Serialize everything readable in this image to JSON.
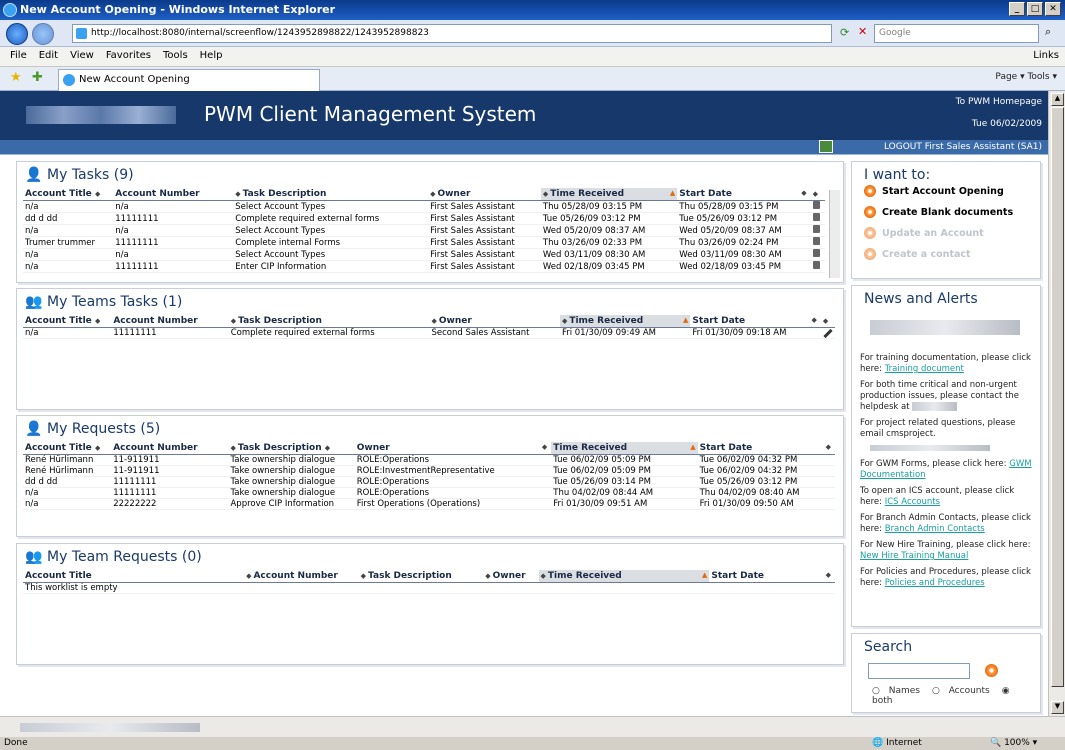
{
  "window": {
    "title": "New Account Opening - Windows Internet Explorer"
  },
  "browser": {
    "address": "http://localhost:8080/internal/screenflow/1243952898822/1243952898823",
    "search_placeholder": "Google",
    "menu": [
      "File",
      "Edit",
      "View",
      "Favorites",
      "Tools",
      "Help"
    ],
    "links_label": "Links",
    "tab_title": "New Account Opening",
    "toolbar_tools": "Page ▾  Tools ▾",
    "status_text": "Done",
    "zone": "Internet",
    "zoom": "100%"
  },
  "header": {
    "system_name": "PWM Client Management System",
    "home_link": "To PWM Homepage",
    "date": "Tue 06/02/2009",
    "logout": "LOGOUT First Sales Assistant (SA1)"
  },
  "my_tasks": {
    "title": "My Tasks (9)",
    "columns": [
      "Account Title",
      "Account Number",
      "Task Description",
      "Owner",
      "Time Received",
      "Start Date"
    ],
    "rows": [
      [
        "n/a",
        "n/a",
        "Select Account Types",
        "First Sales Assistant",
        "Thu 05/28/09 03:15 PM",
        "Thu 05/28/09 03:15 PM"
      ],
      [
        "dd d dd",
        "11111111",
        "Complete required external forms",
        "First Sales Assistant",
        "Tue 05/26/09 03:12 PM",
        "Tue 05/26/09 03:12 PM"
      ],
      [
        "n/a",
        "n/a",
        "Select Account Types",
        "First Sales Assistant",
        "Wed 05/20/09 08:37 AM",
        "Wed 05/20/09 08:37 AM"
      ],
      [
        "Trumer trummer",
        "11111111",
        "Complete internal Forms",
        "First Sales Assistant",
        "Thu 03/26/09 02:33 PM",
        "Thu 03/26/09 02:24 PM"
      ],
      [
        "n/a",
        "n/a",
        "Select Account Types",
        "First Sales Assistant",
        "Wed 03/11/09 08:30 AM",
        "Wed 03/11/09 08:30 AM"
      ],
      [
        "n/a",
        "11111111",
        "Enter CIP Information",
        "First Sales Assistant",
        "Wed 02/18/09 03:45 PM",
        "Wed 02/18/09 03:45 PM"
      ]
    ]
  },
  "my_teams_tasks": {
    "title": "My Teams Tasks (1)",
    "columns": [
      "Account Title",
      "Account Number",
      "Task Description",
      "Owner",
      "Time Received",
      "Start Date"
    ],
    "rows": [
      [
        "n/a",
        "11111111",
        "Complete required external forms",
        "Second Sales Assistant",
        "Fri 01/30/09 09:49 AM",
        "Fri 01/30/09 09:18 AM"
      ]
    ]
  },
  "my_requests": {
    "title": "My Requests (5)",
    "columns": [
      "Account Title",
      "Account Number",
      "Task Description",
      "Owner",
      "Time Received",
      "Start Date"
    ],
    "rows": [
      [
        "René Hürlimann",
        "11-911911",
        "Take ownership dialogue",
        "ROLE:Operations",
        "Tue 06/02/09 05:09 PM",
        "Tue 06/02/09 04:32 PM"
      ],
      [
        "René Hürlimann",
        "11-911911",
        "Take ownership dialogue",
        "ROLE:InvestmentRepresentative",
        "Tue 06/02/09 05:09 PM",
        "Tue 06/02/09 04:32 PM"
      ],
      [
        "dd d dd",
        "11111111",
        "Take ownership dialogue",
        "ROLE:Operations",
        "Tue 05/26/09 03:14 PM",
        "Tue 05/26/09 03:12 PM"
      ],
      [
        "n/a",
        "11111111",
        "Take ownership dialogue",
        "ROLE:Operations",
        "Thu 04/02/09 08:44 AM",
        "Thu 04/02/09 08:40 AM"
      ],
      [
        "n/a",
        "22222222",
        "Approve CIP Information",
        "First Operations (Operations)",
        "Fri 01/30/09 09:51 AM",
        "Fri 01/30/09 09:50 AM"
      ]
    ]
  },
  "my_team_requests": {
    "title": "My Team Requests (0)",
    "columns": [
      "Account Title",
      "Account Number",
      "Task Description",
      "Owner",
      "Time Received",
      "Start Date"
    ],
    "empty_text": "This worklist is empty"
  },
  "i_want_to": {
    "title": "I want to:",
    "items": [
      {
        "label": "Start Account Opening",
        "enabled": true
      },
      {
        "label": "Create Blank documents",
        "enabled": true
      },
      {
        "label": "Update an Account",
        "enabled": false
      },
      {
        "label": "Create a contact",
        "enabled": false
      }
    ]
  },
  "news": {
    "title": "News and Alerts",
    "items": [
      {
        "text": "For training documentation, please click here: ",
        "link": "Training document"
      },
      {
        "text": "For both time critical and non-urgent production issues, please contact the helpdesk at ",
        "link": ""
      },
      {
        "text": "For project related questions, please email cmsproject.",
        "link": ""
      },
      {
        "text": "For GWM Forms, please click here: ",
        "link": "GWM Documentation"
      },
      {
        "text": "To open an ICS account, please click here: ",
        "link": "ICS Accounts"
      },
      {
        "text": "For Branch Admin Contacts, please click here: ",
        "link": "Branch Admin Contacts"
      },
      {
        "text": "For New Hire Training, please click here: ",
        "link": "New Hire Training Manual"
      },
      {
        "text": "For Policies and Procedures, please click here: ",
        "link": "Policies and Procedures"
      }
    ]
  },
  "search": {
    "title": "Search",
    "options": [
      "Names",
      "Accounts",
      "both"
    ],
    "selected": "both"
  },
  "colors": {
    "header_bg": "#16386b",
    "subheader_bg": "#3b6aa8",
    "link": "#18a0a0",
    "accent_orange": "#e0600a"
  }
}
